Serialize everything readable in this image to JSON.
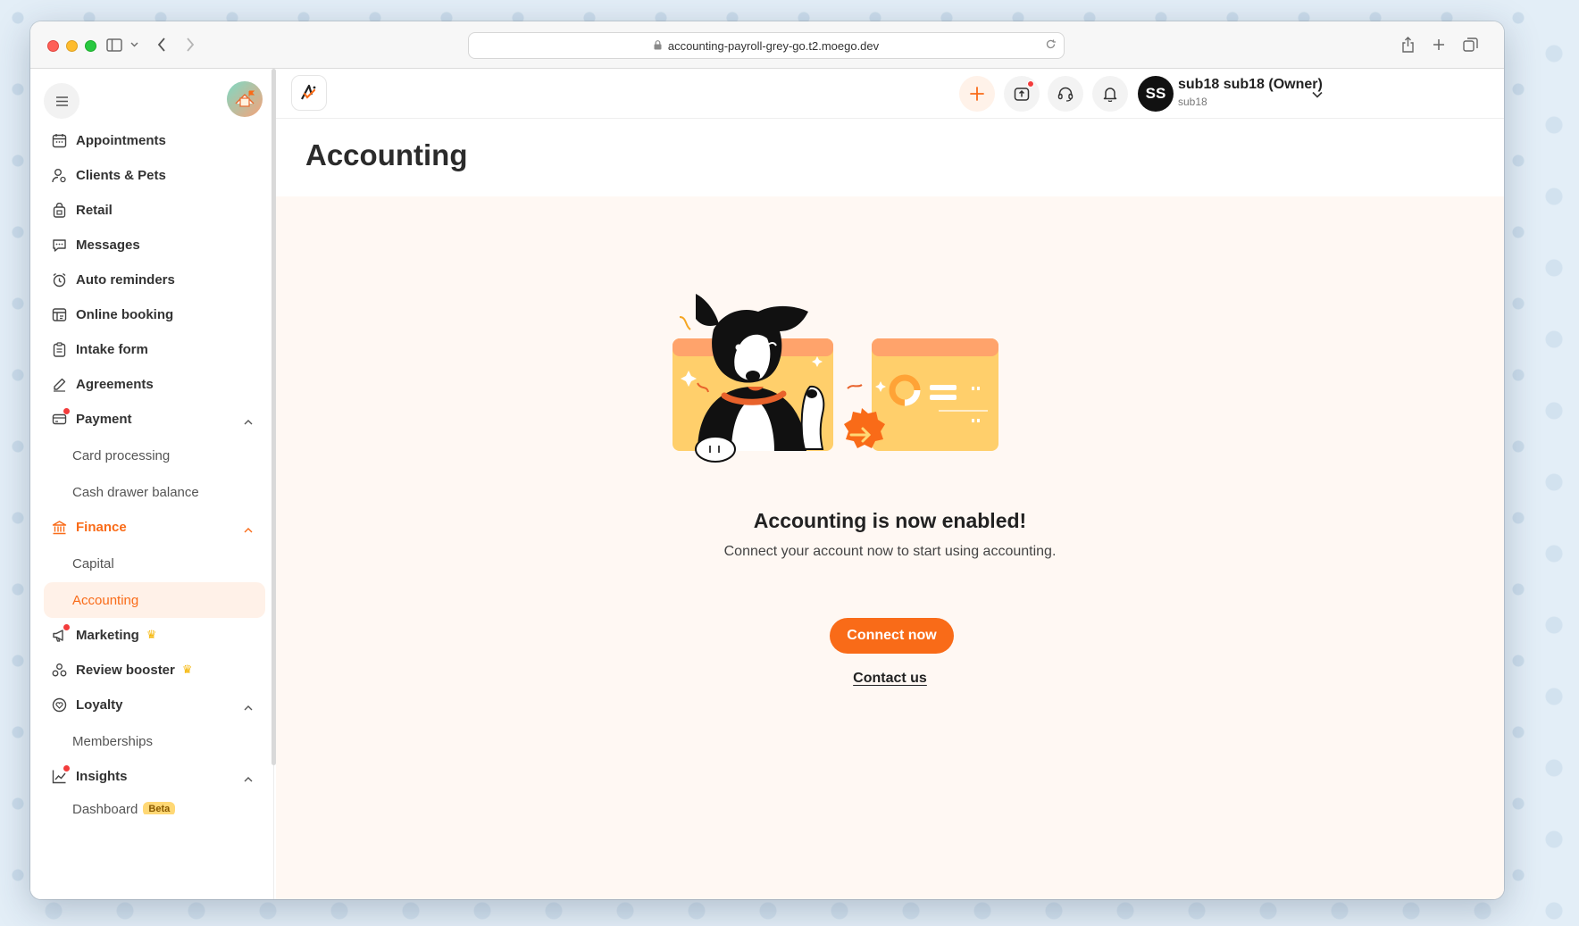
{
  "browser": {
    "url": "accounting-payroll-grey-go.t2.moego.dev"
  },
  "sidebar": {
    "items": [
      {
        "label": "Appointments",
        "icon": "calendar-icon"
      },
      {
        "label": "Clients & Pets",
        "icon": "user-icon"
      },
      {
        "label": "Retail",
        "icon": "bag-icon"
      },
      {
        "label": "Messages",
        "icon": "message-icon"
      },
      {
        "label": "Auto reminders",
        "icon": "alarm-icon"
      },
      {
        "label": "Online booking",
        "icon": "booking-icon"
      },
      {
        "label": "Intake form",
        "icon": "clipboard-icon"
      },
      {
        "label": "Agreements",
        "icon": "pen-icon"
      },
      {
        "label": "Payment",
        "icon": "payment-icon"
      },
      {
        "label": "Finance",
        "icon": "bank-icon"
      },
      {
        "label": "Marketing",
        "icon": "megaphone-icon"
      },
      {
        "label": "Review booster",
        "icon": "review-icon"
      },
      {
        "label": "Loyalty",
        "icon": "heart-icon"
      },
      {
        "label": "Insights",
        "icon": "chart-icon"
      }
    ],
    "payment_sub": [
      "Card processing",
      "Cash drawer balance"
    ],
    "finance_sub": [
      "Capital",
      "Accounting"
    ],
    "loyalty_sub": [
      "Memberships"
    ],
    "insights_sub": {
      "label": "Dashboard",
      "badge": "Beta"
    }
  },
  "header": {
    "user_name": "sub18 sub18 (Owner)",
    "user_sub": "sub18",
    "avatar_initials": "SS"
  },
  "page": {
    "title": "Accounting",
    "empty_title": "Accounting is now enabled!",
    "empty_desc": "Connect your account now to start using accounting.",
    "connect_label": "Connect now",
    "contact_label": "Contact us"
  },
  "colors": {
    "accent": "#f96b18",
    "content_bg": "#fff8f3",
    "active_bg": "#fff1e8"
  }
}
